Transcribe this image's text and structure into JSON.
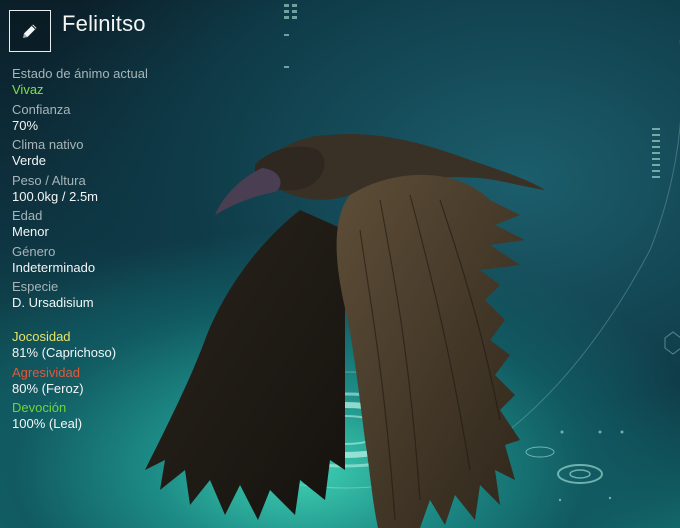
{
  "creature": {
    "name": "Felinitso",
    "edit_icon": "pencil-icon"
  },
  "stats": [
    {
      "label": "Estado de ánimo actual",
      "value": "Vivaz"
    },
    {
      "label": "Confianza",
      "value": "70%"
    },
    {
      "label": "Clima nativo",
      "value": "Verde"
    },
    {
      "label": "Peso / Altura",
      "value": "100.0kg / 2.5m"
    },
    {
      "label": "Edad",
      "value": "Menor"
    },
    {
      "label": "Género",
      "value": "Indeterminado"
    },
    {
      "label": "Especie",
      "value": "D. Ursadisium"
    }
  ],
  "traits": [
    {
      "label": "Jocosidad",
      "value": "81% (Caprichoso)",
      "color": "#e7e36a"
    },
    {
      "label": "Agresividad",
      "value": "80% (Feroz)",
      "color": "#e05a3c"
    },
    {
      "label": "Devoción",
      "value": "100% (Leal)",
      "color": "#6fd63a"
    }
  ],
  "colors": {
    "mood": "#7ee04a",
    "label": "#a7b5b8",
    "value": "#f3f6f6"
  }
}
